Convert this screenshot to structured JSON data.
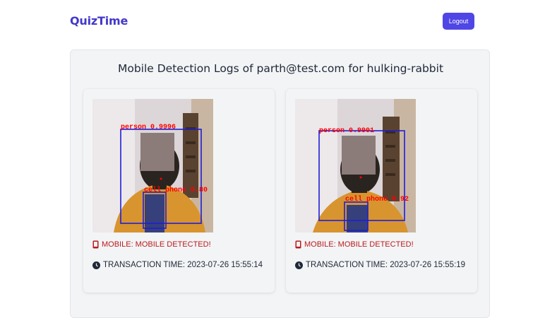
{
  "nav": {
    "brand": "QuizTime",
    "logout_label": "Logout"
  },
  "page": {
    "title": "Mobile Detection Logs of parth@test.com for hulking-rabbit"
  },
  "logs": [
    {
      "status": "MOBILE: MOBILE DETECTED!",
      "time_text": "TRANSACTION TIME: 2023-07-26 15:55:14",
      "label_person": "person 0.9996",
      "label_phone": "cell phone 0.80"
    },
    {
      "status": "MOBILE: MOBILE DETECTED!",
      "time_text": "TRANSACTION TIME: 2023-07-26 15:55:19",
      "label_person": "person 0.9901",
      "label_phone": "cell phone 0.92"
    }
  ],
  "icons": {
    "mobile": "mobile-phone-icon",
    "time": "clock-icon"
  },
  "colors": {
    "brand": "#4338ca",
    "button": "#4f46e5",
    "alert": "#b91c1c",
    "box": "#1e1ed8",
    "label": "#ff0000"
  }
}
